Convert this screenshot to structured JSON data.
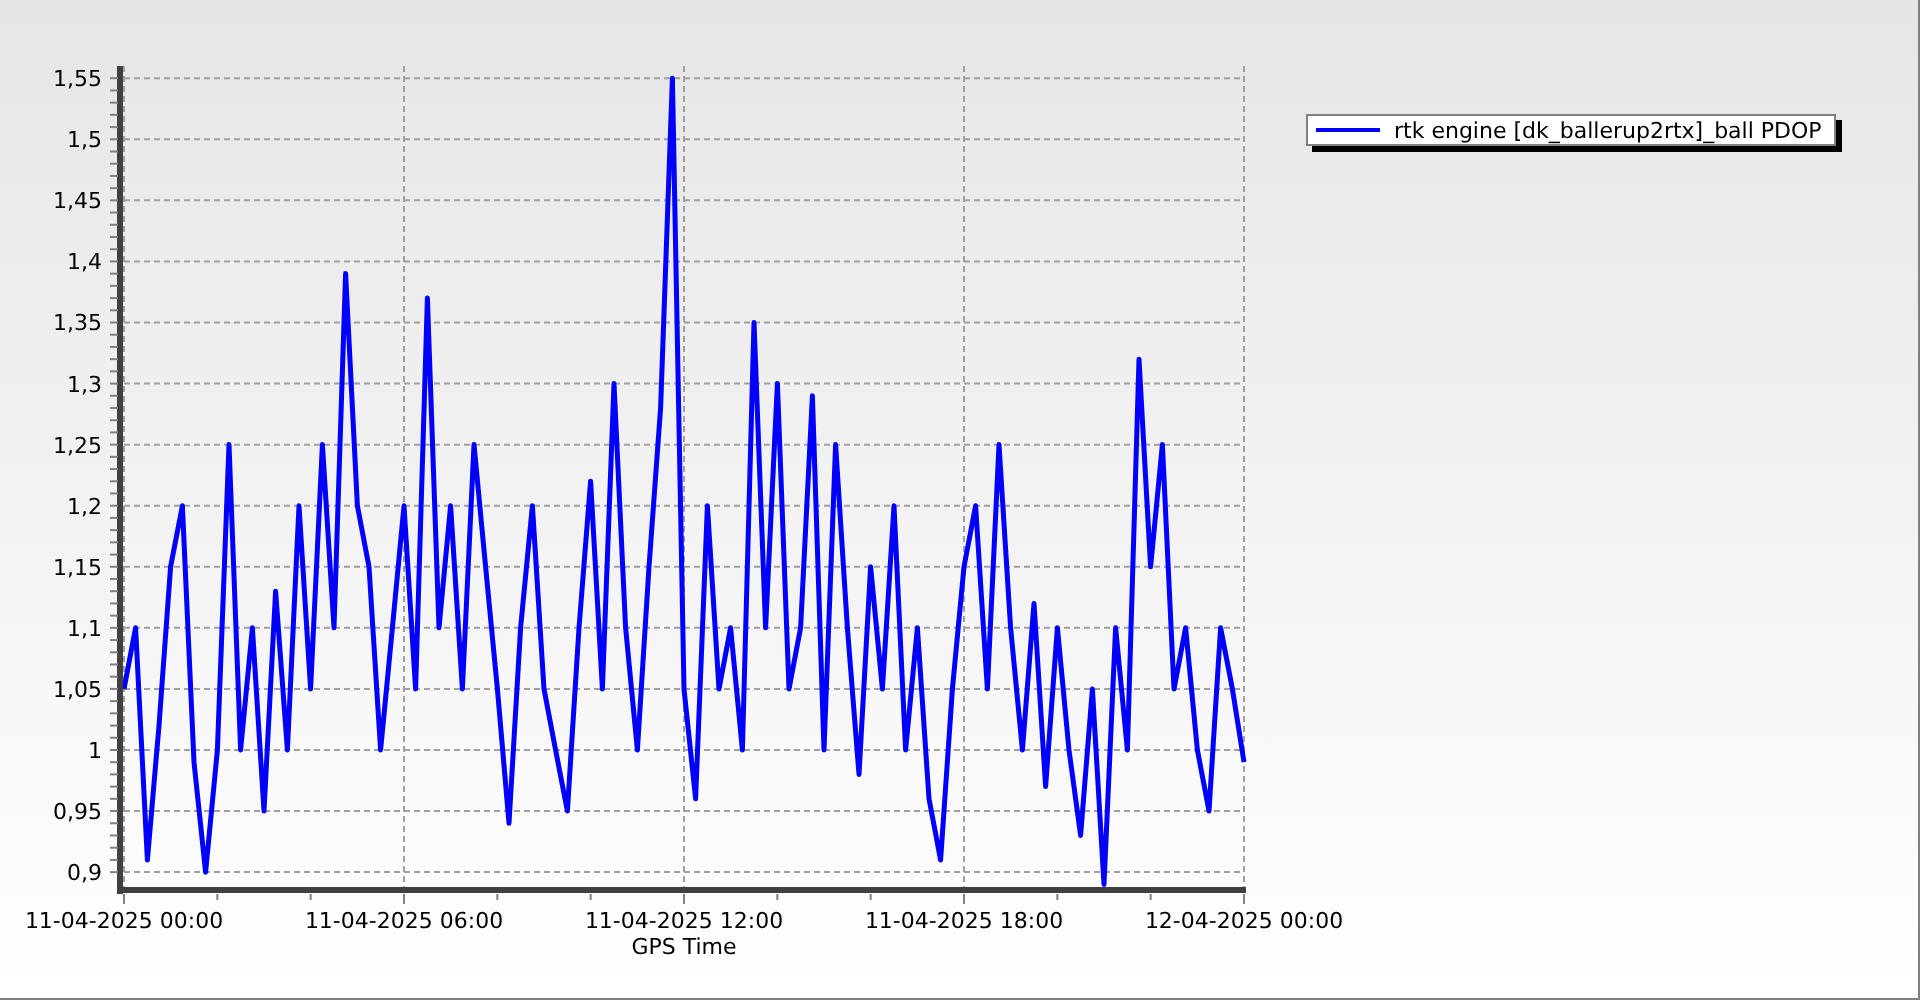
{
  "chart": {
    "chart_data": {
      "type": "line",
      "xlabel": "GPS Time",
      "categories": [
        "11-04-2025 00:00",
        null,
        null,
        null,
        null,
        null,
        null,
        null,
        null,
        null,
        null,
        null,
        null,
        null,
        null,
        null,
        null,
        null,
        null,
        null,
        null,
        null,
        null,
        null,
        "11-04-2025 06:00",
        null,
        null,
        null,
        null,
        null,
        null,
        null,
        null,
        null,
        null,
        null,
        null,
        null,
        null,
        null,
        null,
        null,
        null,
        null,
        null,
        null,
        null,
        null,
        "11-04-2025 12:00",
        null,
        null,
        null,
        null,
        null,
        null,
        null,
        null,
        null,
        null,
        null,
        null,
        null,
        null,
        null,
        null,
        null,
        null,
        null,
        null,
        null,
        null,
        null,
        "11-04-2025 18:00",
        null,
        null,
        null,
        null,
        null,
        null,
        null,
        null,
        null,
        null,
        null,
        null,
        null,
        null,
        null,
        null,
        null,
        null,
        null,
        null,
        null,
        null,
        null,
        "12-04-2025 00:00"
      ],
      "series": [
        {
          "name": "rtk engine [dk_ballerup2rtx]_ball PDOP",
          "color": "#0000ff",
          "values": [
            1.05,
            1.1,
            0.91,
            1.02,
            1.15,
            1.2,
            0.99,
            0.9,
            1.0,
            1.25,
            1.0,
            1.1,
            0.95,
            1.13,
            1.0,
            1.2,
            1.05,
            1.25,
            1.1,
            1.39,
            1.2,
            1.15,
            1.0,
            1.1,
            1.2,
            1.05,
            1.37,
            1.1,
            1.2,
            1.05,
            1.25,
            1.15,
            1.05,
            0.94,
            1.1,
            1.2,
            1.05,
            1.0,
            0.95,
            1.1,
            1.22,
            1.05,
            1.3,
            1.1,
            1.0,
            1.15,
            1.28,
            1.55,
            1.05,
            0.96,
            1.2,
            1.05,
            1.1,
            1.0,
            1.35,
            1.1,
            1.3,
            1.05,
            1.1,
            1.29,
            1.0,
            1.25,
            1.1,
            0.98,
            1.15,
            1.05,
            1.2,
            1.0,
            1.1,
            0.96,
            0.91,
            1.05,
            1.15,
            1.2,
            1.05,
            1.25,
            1.1,
            1.0,
            1.12,
            0.97,
            1.1,
            1.0,
            0.93,
            1.05,
            0.89,
            1.1,
            1.0,
            1.32,
            1.15,
            1.25,
            1.05,
            1.1,
            1.0,
            0.95,
            1.1,
            1.05,
            0.99
          ]
        }
      ],
      "ylim": [
        0.887,
        1.56
      ],
      "grid": true,
      "yticks": [
        {
          "value": 0.9,
          "label": "0,9"
        },
        {
          "value": 0.95,
          "label": "0,95"
        },
        {
          "value": 1,
          "label": "1"
        },
        {
          "value": 1.05,
          "label": "1,05"
        },
        {
          "value": 1.1,
          "label": "1,1"
        },
        {
          "value": 1.15,
          "label": "1,15"
        },
        {
          "value": 1.2,
          "label": "1,2"
        },
        {
          "value": 1.25,
          "label": "1,25"
        },
        {
          "value": 1.3,
          "label": "1,3"
        },
        {
          "value": 1.35,
          "label": "1,35"
        },
        {
          "value": 1.4,
          "label": "1,4"
        },
        {
          "value": 1.45,
          "label": "1,45"
        },
        {
          "value": 1.5,
          "label": "1,5"
        },
        {
          "value": 1.55,
          "label": "1,55"
        }
      ]
    }
  }
}
